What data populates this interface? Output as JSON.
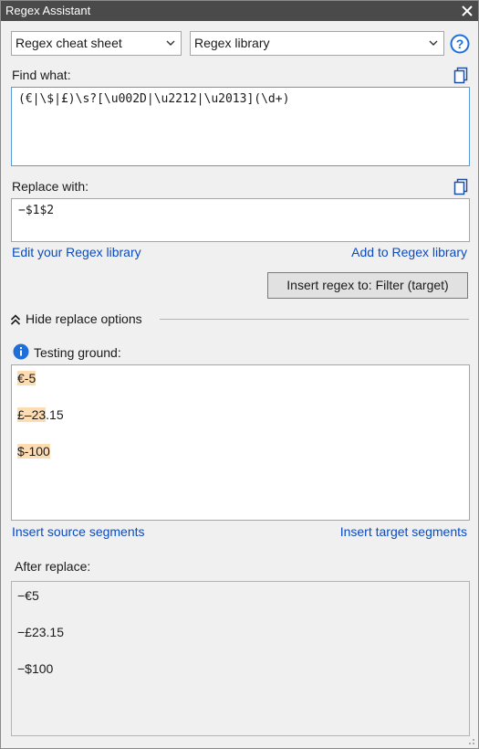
{
  "window": {
    "title": "Regex Assistant"
  },
  "toolbar": {
    "cheat_sheet": "Regex cheat sheet",
    "library": "Regex library"
  },
  "find": {
    "label": "Find what:",
    "value": "(€|\\$|£)\\s?[\\u002D|\\u2212|\\u2013](\\d+)"
  },
  "replace": {
    "label": "Replace with:",
    "value": "−$1$2"
  },
  "links": {
    "edit_library": "Edit your Regex library",
    "add_library": "Add to Regex library",
    "insert_source": "Insert source segments",
    "insert_target": "Insert target segments"
  },
  "insert_button": "Insert regex to: Filter (target)",
  "replace_options_toggle": "Hide replace options",
  "testing": {
    "label": "Testing ground:",
    "lines": [
      {
        "match": "€-5",
        "rest": ""
      },
      {
        "match": "£–23",
        "rest": ".15"
      },
      {
        "match": "$-100",
        "rest": ""
      }
    ]
  },
  "after": {
    "label": "After replace:",
    "lines": [
      "−€5",
      "−£23.15",
      "−$100"
    ]
  },
  "colors": {
    "titlebar": "#4a4a4a",
    "link": "#0a4bbf",
    "highlight": "#fddcb2",
    "focus_border": "#5b9bd5",
    "info_icon": "#1e6fd9"
  }
}
